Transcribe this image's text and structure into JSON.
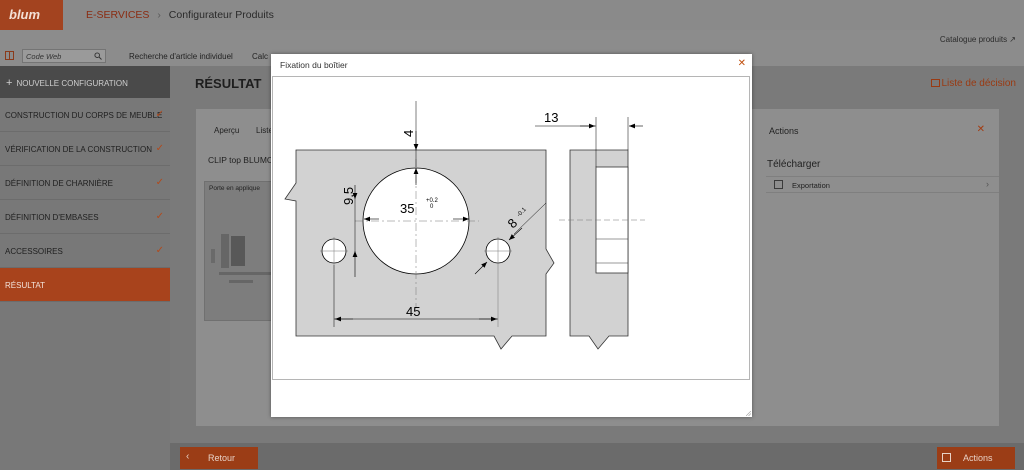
{
  "header": {
    "logo": "blum",
    "breadcrumb_link": "E-SERVICES",
    "breadcrumb_current": "Configurateur Produits"
  },
  "toolbar": {
    "catalog_link": "Catalogue produits",
    "search_placeholder": "Code Web",
    "items": [
      "Recherche d'article individuel",
      "Calc"
    ]
  },
  "sidebar": {
    "new_config": "NOUVELLE CONFIGURATION",
    "items": [
      {
        "label": "CONSTRUCTION DU CORPS DE MEUBLE",
        "done": true
      },
      {
        "label": "VÉRIFICATION DE LA CONSTRUCTION",
        "done": true
      },
      {
        "label": "DÉFINITION DE CHARNIÈRE",
        "done": true
      },
      {
        "label": "DÉFINITION D'EMBASES",
        "done": true
      },
      {
        "label": "ACCESSOIRES",
        "done": true
      },
      {
        "label": "RÉSULTAT",
        "done": false,
        "active": true
      }
    ]
  },
  "main": {
    "title": "RÉSULTAT",
    "decision_link": "Liste de décision",
    "tabs": [
      "Aperçu",
      "Liste"
    ],
    "product": "CLIP top BLUMO",
    "image_label": "Porte en applique",
    "actions_title": "Actions",
    "download_title": "Télécharger",
    "export_label": "Exportation"
  },
  "modal": {
    "title": "Fixation du boîtier",
    "dimensions": {
      "top_offset": "4",
      "width_side": "13",
      "vertical": "9,5",
      "cup_diameter": "35",
      "tolerance_upper": "+0.2",
      "tolerance_lower": "0",
      "hole_diameter": "8",
      "hole_tolerance": "-0.1",
      "spacing": "45"
    }
  },
  "footer": {
    "back_label": "Retour",
    "actions_label": "Actions"
  },
  "colors": {
    "brand": "#a8431c",
    "accent": "#c0500f",
    "part_fill": "#d2d2d2"
  }
}
